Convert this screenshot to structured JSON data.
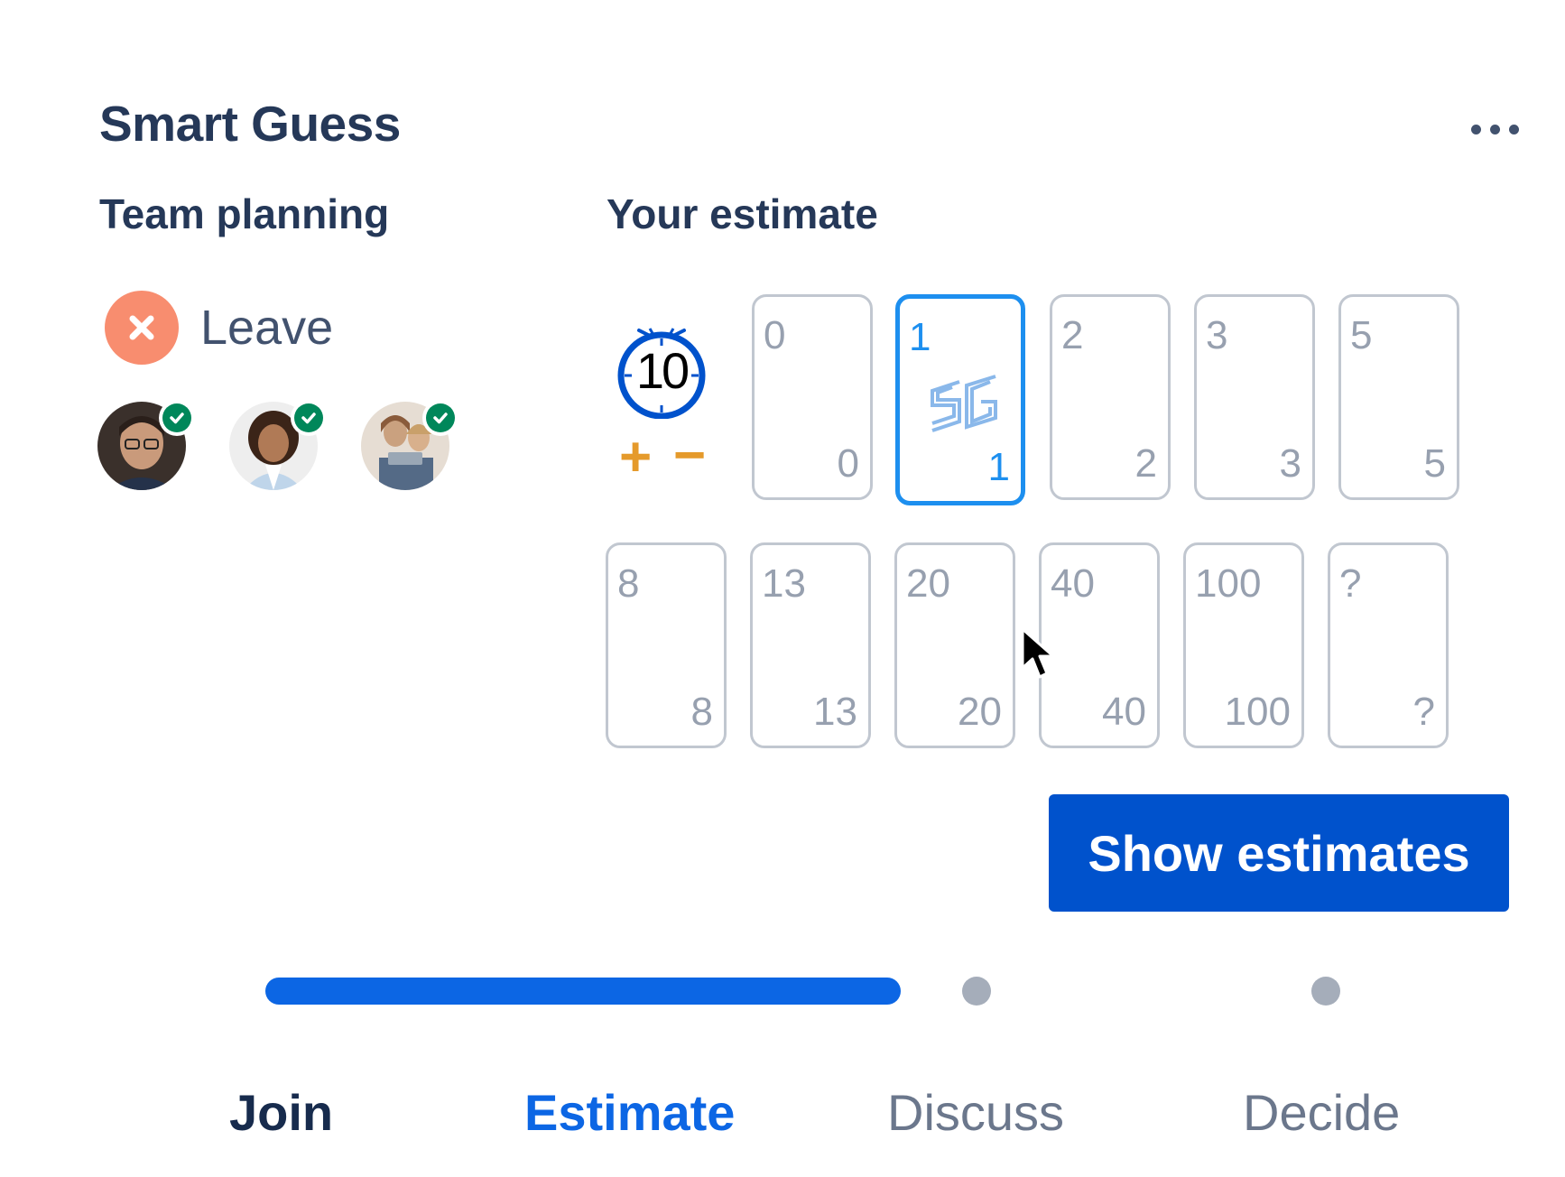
{
  "header": {
    "title": "Smart Guess",
    "more_icon": "more-horizontal-icon"
  },
  "team": {
    "title": "Team planning",
    "leave_label": "Leave",
    "leave_color": "#f88d6f",
    "members": [
      {
        "avatar": "avatar-man-glasses",
        "status": "ready"
      },
      {
        "avatar": "avatar-woman-curly-hair",
        "status": "ready"
      },
      {
        "avatar": "avatar-woman-laptop",
        "status": "ready"
      }
    ]
  },
  "estimate": {
    "title": "Your estimate",
    "timer": {
      "value": "10",
      "plus": "+",
      "minus": "−"
    },
    "selected": "1",
    "cards_row1": [
      "0",
      "1",
      "2",
      "3",
      "5"
    ],
    "cards_row2": [
      "8",
      "13",
      "20",
      "40",
      "100",
      "?"
    ]
  },
  "actions": {
    "show_estimates": "Show estimates",
    "button_color": "#0052cc"
  },
  "progress": {
    "fraction": 0.6,
    "fill_color": "#0c66e4",
    "steps": [
      {
        "label": "Join",
        "state": "done"
      },
      {
        "label": "Estimate",
        "state": "current"
      },
      {
        "label": "Discuss",
        "state": "pending"
      },
      {
        "label": "Decide",
        "state": "pending"
      }
    ]
  }
}
